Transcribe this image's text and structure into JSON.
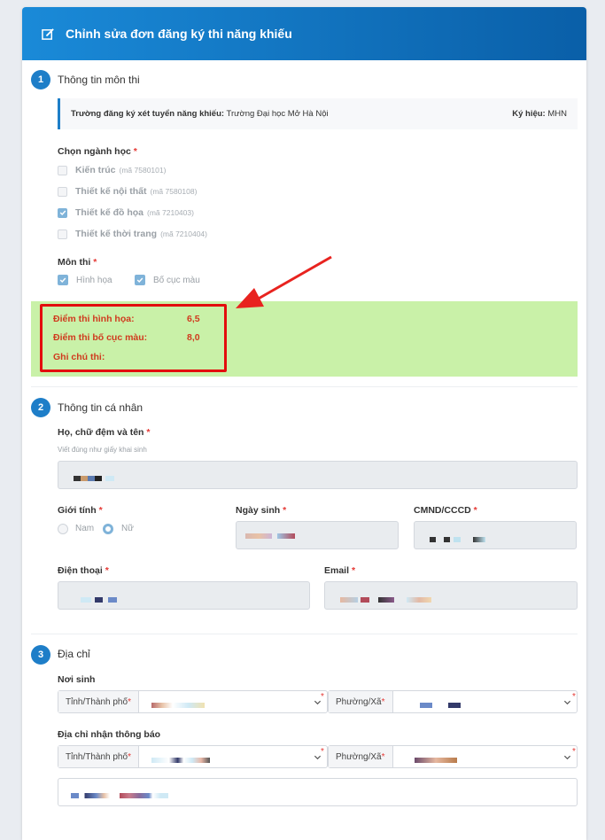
{
  "header": {
    "title": "Chỉnh sửa đơn đăng ký thi năng khiếu",
    "icon": "edit-icon"
  },
  "section1": {
    "number": "1",
    "title": "Thông tin môn thi",
    "school_label": "Trường đăng ký xét tuyển năng khiếu:",
    "school_value": "Trường Đại học Mở Hà Nội",
    "code_label": "Ký hiệu:",
    "code_value": "MHN",
    "major_label": "Chọn ngành học",
    "majors": [
      {
        "name": "Kiến trúc",
        "code": "(mã 7580101)",
        "checked": false
      },
      {
        "name": "Thiết kế nội thất",
        "code": "(mã 7580108)",
        "checked": false
      },
      {
        "name": "Thiết kế đồ họa",
        "code": "(mã 7210403)",
        "checked": true
      },
      {
        "name": "Thiết kế thời trang",
        "code": "(mã 7210404)",
        "checked": false
      }
    ],
    "subject_label": "Môn thi",
    "subjects": [
      {
        "name": "Hình họa",
        "checked": true
      },
      {
        "name": "Bố cục màu",
        "checked": true
      }
    ],
    "scores": {
      "drawing_label": "Điểm thi hình họa:",
      "drawing_value": "6,5",
      "color_label": "Điểm thi bố cục màu:",
      "color_value": "8,0",
      "note_label": "Ghi chú thi:",
      "note_value": ""
    }
  },
  "section2": {
    "number": "2",
    "title": "Thông tin cá nhân",
    "fullname_label": "Họ, chữ đệm và tên",
    "fullname_hint": "Viết đúng như giấy khai sinh",
    "gender_label": "Giới tính",
    "gender_options": [
      "Nam",
      "Nữ"
    ],
    "gender_selected": "Nữ",
    "dob_label": "Ngày sinh",
    "id_label": "CMND/CCCD",
    "phone_label": "Điện thoại",
    "email_label": "Email"
  },
  "section3": {
    "number": "3",
    "title": "Địa chỉ",
    "birthplace_label": "Nơi sinh",
    "notify_label": "Địa chỉ nhận thông báo",
    "province_label": "Tỉnh/Thành phố",
    "ward_label": "Phường/Xã"
  },
  "colors": {
    "accent": "#1e7ec8",
    "highlight": "#c9f1a8",
    "alert": "#e30d0d"
  }
}
